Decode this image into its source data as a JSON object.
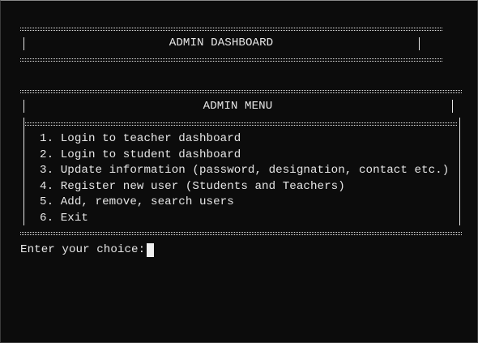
{
  "dashboard": {
    "title": "ADMIN DASHBOARD"
  },
  "menu": {
    "title": "ADMIN MENU",
    "items": [
      "1. Login to teacher dashboard",
      "2. Login to student dashboard",
      "3. Update information (password, designation, contact etc.)",
      "4. Register new user (Students and Teachers)",
      "5. Add, remove, search users",
      "6. Exit"
    ]
  },
  "prompt": {
    "label": "Enter your choice:"
  },
  "colors": {
    "background": "#0c0c0c",
    "foreground": "#e6e6e6",
    "cursor": "#f0f0f0"
  }
}
